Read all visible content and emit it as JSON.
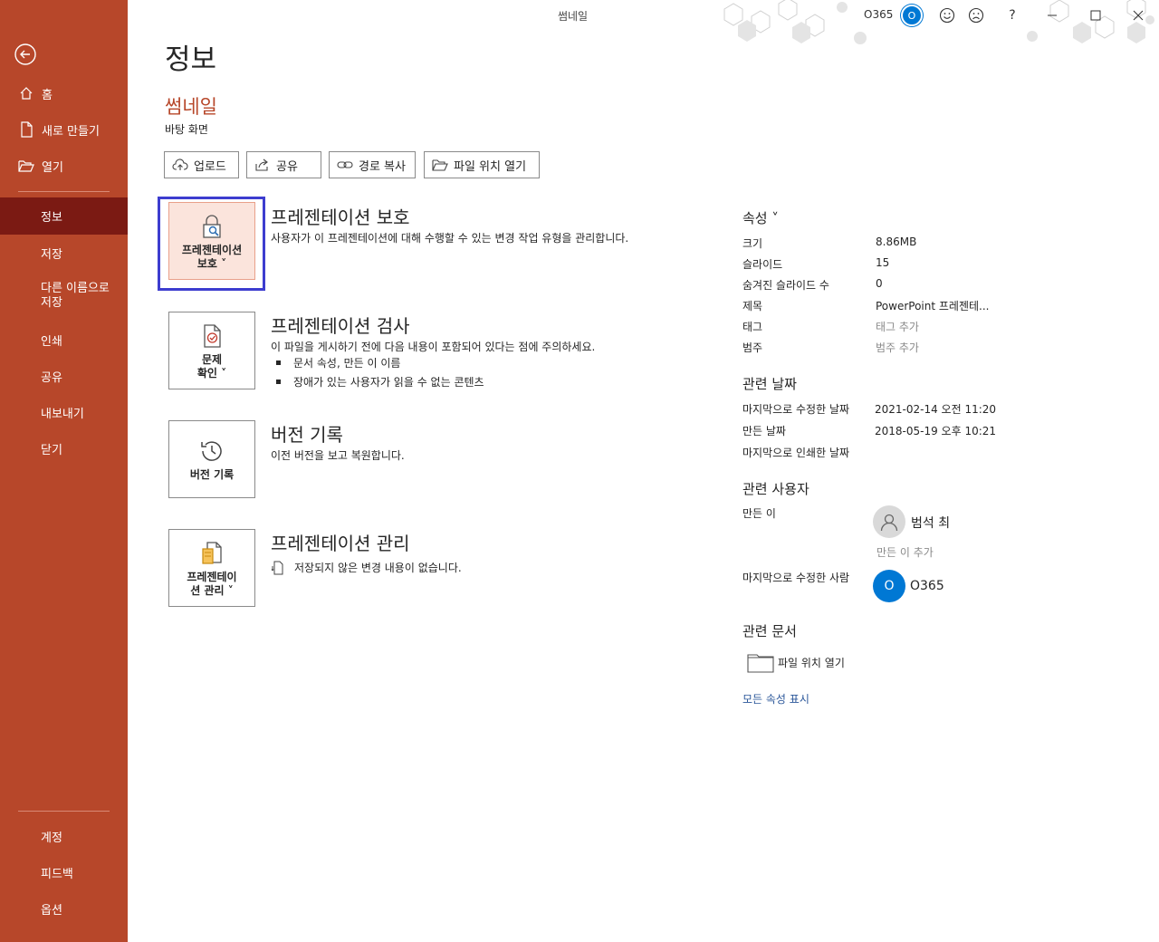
{
  "window": {
    "title": "썸네일",
    "account_label": "O365",
    "avatar_initial": "O"
  },
  "sidebar": {
    "items": [
      {
        "label": "홈",
        "icon": "home-icon"
      },
      {
        "label": "새로 만들기",
        "icon": "new-document-icon"
      },
      {
        "label": "열기",
        "icon": "folder-open-icon"
      },
      {
        "label": "정보"
      },
      {
        "label": "저장"
      },
      {
        "label": "다른 이름으로 저장"
      },
      {
        "label": "인쇄"
      },
      {
        "label": "공유"
      },
      {
        "label": "내보내기"
      },
      {
        "label": "닫기"
      }
    ],
    "bottom_items": [
      {
        "label": "계정"
      },
      {
        "label": "피드백"
      },
      {
        "label": "옵션"
      }
    ],
    "active_item": "정보",
    "accent": "#b7472a",
    "active_color": "#7b1a13"
  },
  "page": {
    "title": "정보",
    "file_name": "썸네일",
    "file_location": "바탕 화면"
  },
  "actions": [
    {
      "label": "업로드",
      "icon": "cloud-upload-icon"
    },
    {
      "label": "공유",
      "icon": "share-icon"
    },
    {
      "label": "경로 복사",
      "icon": "link-icon"
    },
    {
      "label": "파일 위치 열기",
      "icon": "folder-open-icon"
    }
  ],
  "sections": {
    "protect": {
      "button_line1": "프레젠테이션",
      "button_line2": "보호 ˅",
      "title": "프레젠테이션 보호",
      "desc": "사용자가 이 프레젠테이션에 대해 수행할 수 있는 변경 작업 유형을 관리합니다."
    },
    "inspect": {
      "button_line1": "문제",
      "button_line2": "확인 ˅",
      "title": "프레젠테이션 검사",
      "desc": "이 파일을 게시하기 전에 다음 내용이 포함되어 있다는 점에 주의하세요.",
      "bullets": [
        "문서 속성, 만든 이 이름",
        "장애가 있는 사용자가 읽을 수 없는 콘텐츠"
      ]
    },
    "history": {
      "button_label": "버전 기록",
      "title": "버전 기록",
      "desc": "이전 버전을 보고 복원합니다."
    },
    "manage": {
      "button_line1": "프레젠테이",
      "button_line2": "션 관리 ˅",
      "title": "프레젠테이션 관리",
      "desc": "저장되지 않은 변경 내용이 없습니다."
    }
  },
  "properties": {
    "heading": "속성 ˅",
    "rows": [
      {
        "label": "크기",
        "value": "8.86MB"
      },
      {
        "label": "슬라이드",
        "value": "15"
      },
      {
        "label": "숨겨진 슬라이드 수",
        "value": "0"
      },
      {
        "label": "제목",
        "value": "PowerPoint 프레젠테..."
      },
      {
        "label": "태그",
        "value": "태그 추가"
      },
      {
        "label": "범주",
        "value": "범주 추가"
      }
    ]
  },
  "related_dates": {
    "heading": "관련 날짜",
    "rows": [
      {
        "label": "마지막으로 수정한 날짜",
        "value": "2021-02-14 오전 11:20"
      },
      {
        "label": "만든 날짜",
        "value": "2018-05-19 오후 10:21"
      },
      {
        "label": "마지막으로 인쇄한 날짜",
        "value": ""
      }
    ]
  },
  "related_people": {
    "heading": "관련 사용자",
    "author_label": "만든 이",
    "author_name": "범석 최",
    "add_author": "만든 이 추가",
    "modifier_label": "마지막으로 수정한 사람",
    "modifier_name": "O365",
    "modifier_initial": "O"
  },
  "related_docs": {
    "heading": "관련 문서",
    "open_location": "파일 위치 열기"
  },
  "show_all_link": "모든 속성 표시"
}
